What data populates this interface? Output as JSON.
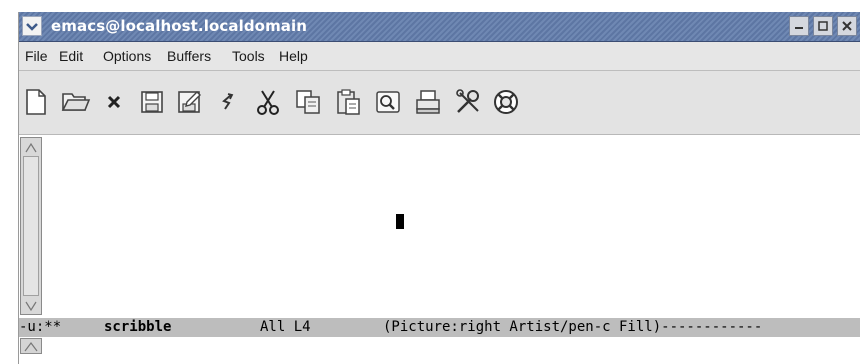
{
  "window": {
    "title": "emacs@localhost.localdomain"
  },
  "menu": {
    "items": [
      "File",
      "Edit",
      "Options",
      "Buffers",
      "Tools",
      "Help"
    ]
  },
  "toolbar": {
    "icons": [
      "new-file-icon",
      "open-folder-icon",
      "close-icon",
      "save-icon",
      "save-as-icon",
      "undo-icon",
      "cut-icon",
      "copy-icon",
      "paste-icon",
      "search-icon",
      "print-icon",
      "customize-icon",
      "help-lifebuoy-icon"
    ]
  },
  "modeline": {
    "status": "-u:**",
    "buffer": "scribble",
    "position": "All L4",
    "modes": "(Picture:right Artist/pen-c Fill)------------"
  },
  "colors": {
    "titlebar": "#6a83b0",
    "menubar": "#e6e6e6",
    "modeline": "#bdbdbd"
  }
}
